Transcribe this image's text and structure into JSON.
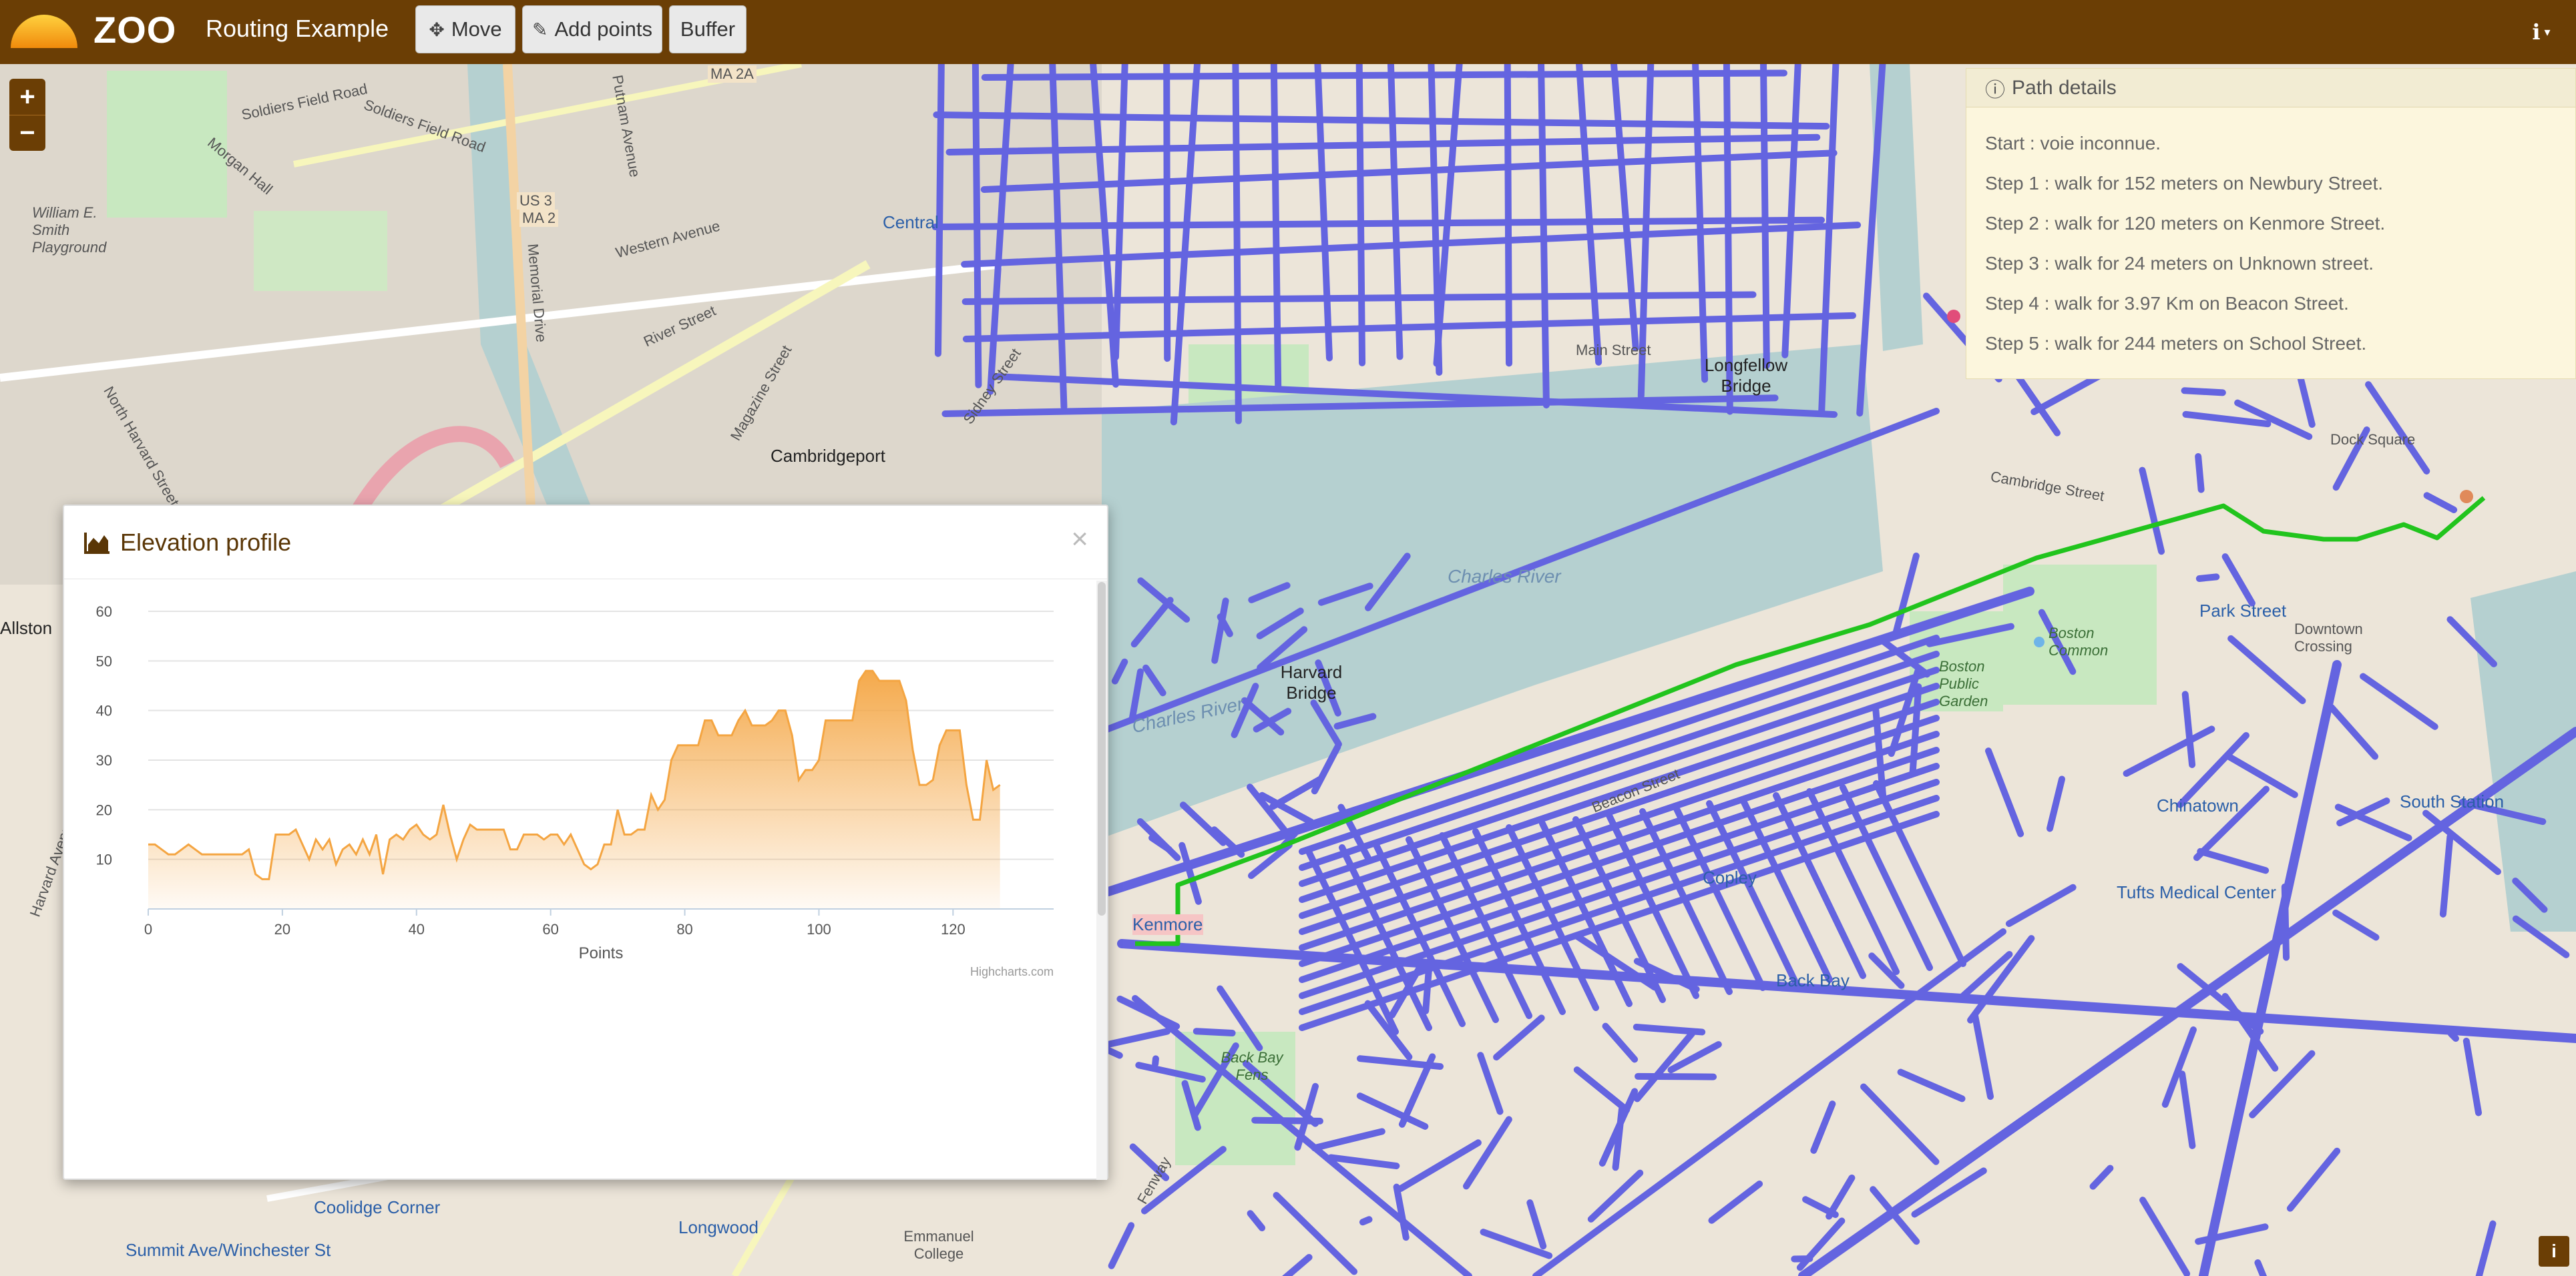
{
  "app": {
    "brand": "ZOO",
    "title": "Routing Example"
  },
  "toolbar": {
    "move_label": "Move",
    "add_points_label": "Add points",
    "buffer_label": "Buffer",
    "move_icon": "move-icon",
    "add_points_icon": "pencil-icon"
  },
  "colors": {
    "navbar": "#6b3e05",
    "route": "#21c41d",
    "roads": "#6464e0",
    "water": "#b5d0d0",
    "chart_line": "#f4a542"
  },
  "map": {
    "labels": [
      "Soldiers Field Road",
      "Soldiers Field Road",
      "Morgan Hall",
      "William E. Smith Playground",
      "Putnam Avenue",
      "Western Avenue",
      "Memorial Drive",
      "River Street",
      "Central",
      "Magazine Street",
      "Cambridgeport",
      "Sidney Street",
      "US 3",
      "MA 2",
      "MA 2A",
      "Charles River",
      "Charles River",
      "Harvard Bridge",
      "Longfellow Bridge",
      "Main Street",
      "Boston Common",
      "Boston Public Garden",
      "Park Street",
      "Kenmore",
      "Back Bay",
      "Back Bay Fens",
      "Tufts Medical Center",
      "Chinatown",
      "Copley",
      "Coolidge Corner",
      "Longwood",
      "Summit Ave/Winchester St",
      "Dock Square",
      "Downtown Crossing",
      "South Station",
      "Harvard Avenue",
      "North Harvard Street",
      "Allston",
      "Emmanuel College",
      "Fenway",
      "Beacon Street",
      "Cambridge Street"
    ]
  },
  "path_details": {
    "title": "Path details",
    "steps": [
      "Start : voie inconnue.",
      "Step 1 : walk for 152 meters on Newbury Street.",
      "Step 2 : walk for 120 meters on Kenmore Street.",
      "Step 3 : walk for 24 meters on Unknown street.",
      "Step 4 : walk for 3.97 Km on Beacon Street.",
      "Step 5 : walk for 244 meters on School Street."
    ]
  },
  "elevation": {
    "title": "Elevation profile",
    "close": "×",
    "credit": "Highcharts.com"
  },
  "chart_data": {
    "type": "area",
    "title": "",
    "xlabel": "Points",
    "ylabel": "",
    "xlim": [
      0,
      135
    ],
    "ylim": [
      0,
      60
    ],
    "x_ticks": [
      0,
      20,
      40,
      60,
      80,
      100,
      120
    ],
    "y_ticks": [
      10,
      20,
      30,
      40,
      50,
      60
    ],
    "grid": true,
    "legend": "none",
    "series": [
      {
        "values": [
          13,
          13,
          12,
          11,
          11,
          12,
          13,
          12,
          11,
          11,
          11,
          11,
          11,
          11,
          11,
          12,
          7,
          6,
          6,
          15,
          15,
          15,
          16,
          13,
          10,
          14,
          12,
          14,
          9,
          12,
          13,
          11,
          14,
          11,
          15,
          7,
          14,
          15,
          14,
          16,
          17,
          15,
          14,
          15,
          21,
          15,
          10,
          14,
          17,
          16,
          16,
          16,
          16,
          16,
          12,
          12,
          15,
          15,
          15,
          14,
          15,
          15,
          13,
          15,
          12,
          9,
          8,
          9,
          13,
          13,
          20,
          15,
          15,
          16,
          16,
          23,
          20,
          22,
          30,
          33,
          33,
          33,
          33,
          38,
          38,
          35,
          35,
          35,
          38,
          40,
          37,
          37,
          37,
          38,
          40,
          40,
          35,
          26,
          28,
          28,
          30,
          38,
          38,
          38,
          38,
          38,
          46,
          48,
          48,
          46,
          46,
          46,
          46,
          42,
          32,
          25,
          25,
          26,
          33,
          36,
          36,
          36,
          25,
          18,
          18,
          30,
          24,
          25
        ]
      }
    ]
  }
}
